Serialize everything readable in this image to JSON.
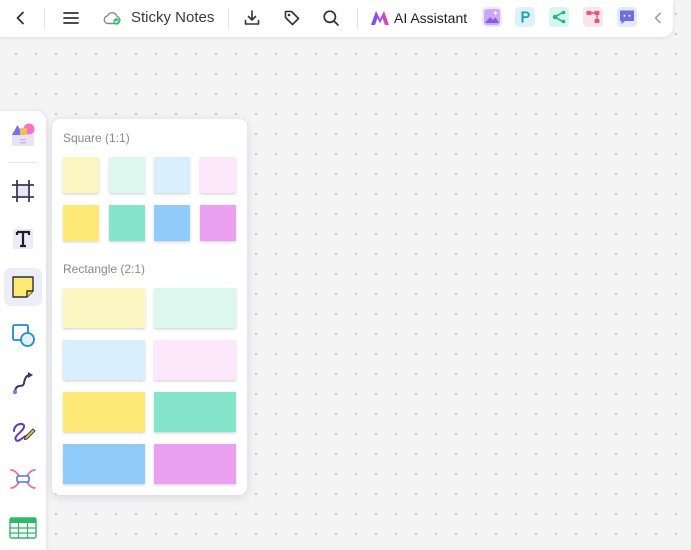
{
  "toolbar": {
    "doc_title": "Sticky Notes",
    "ai_assistant_label": "AI Assistant",
    "icons": [
      "back-icon",
      "menu-icon",
      "cloud-saved-icon",
      "download-icon",
      "tag-icon",
      "search-icon",
      "ai-logo-icon",
      "image-generator-icon",
      "presentation-app-icon",
      "mindmap-app-icon",
      "flowchart-app-icon",
      "chat-app-icon",
      "collapse-icon"
    ]
  },
  "left_rail": {
    "tools": [
      "templates",
      "frame",
      "text",
      "sticky-note",
      "shape",
      "connector",
      "pen",
      "mind-map",
      "table"
    ],
    "active_tool": "sticky-note"
  },
  "sticky_panel": {
    "square_title": "Square (1:1)",
    "rect_title": "Rectangle (2:1)",
    "colors": {
      "yellow_light": "#fbf6c2",
      "mint_light": "#dcf7ee",
      "blue_light": "#d8eefc",
      "pink_light": "#fde7fb",
      "yellow": "#fde876",
      "mint": "#84e5cb",
      "blue": "#90cbfa",
      "violet": "#eba1f1"
    }
  }
}
